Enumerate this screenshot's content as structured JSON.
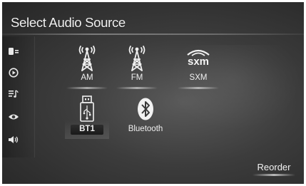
{
  "header": {
    "title": "Select Audio Source"
  },
  "sidebar": {
    "items": [
      {
        "icon": "phone-menu-icon"
      },
      {
        "icon": "play-circle-icon"
      },
      {
        "icon": "playlist-icon"
      },
      {
        "icon": "eye-icon"
      },
      {
        "icon": "speaker-volume-icon"
      }
    ]
  },
  "sources": [
    {
      "label": "AM",
      "icon": "radio-tower-icon"
    },
    {
      "label": "FM",
      "icon": "radio-tower-icon"
    },
    {
      "label": "SXM",
      "icon": "sxm-logo",
      "logo_text": "sxm"
    },
    {
      "label": "BT1",
      "icon": "usb-icon",
      "selected": true
    },
    {
      "label": "Bluetooth",
      "icon": "bluetooth-icon"
    }
  ],
  "footer": {
    "reorder_label": "Reorder"
  }
}
